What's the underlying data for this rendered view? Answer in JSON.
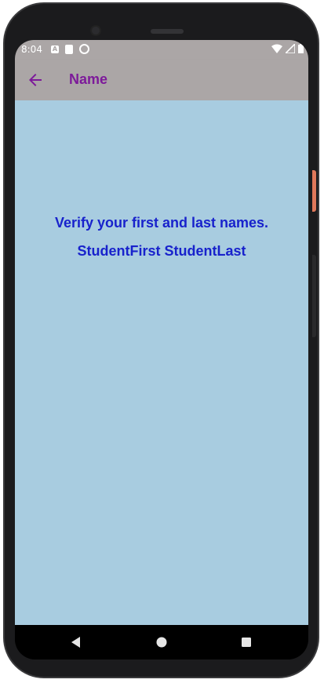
{
  "status_bar": {
    "time": "8:04",
    "icons": [
      "accessibility-a-icon",
      "sd-card-icon",
      "sync-icon",
      "wifi-icon",
      "signal-icon",
      "battery-icon"
    ]
  },
  "app_bar": {
    "title": "Name",
    "back_icon": "arrow-back-icon"
  },
  "content": {
    "prompt": "Verify your first and last names.",
    "full_name": "StudentFirst StudentLast"
  },
  "nav_bar": {
    "buttons": [
      "back-triangle-icon",
      "home-circle-icon",
      "recents-square-icon"
    ]
  },
  "colors": {
    "app_bar_bg": "#aba6a6",
    "title": "#7d1a9a",
    "content_bg": "#a8cce0",
    "text": "#1822cc"
  }
}
